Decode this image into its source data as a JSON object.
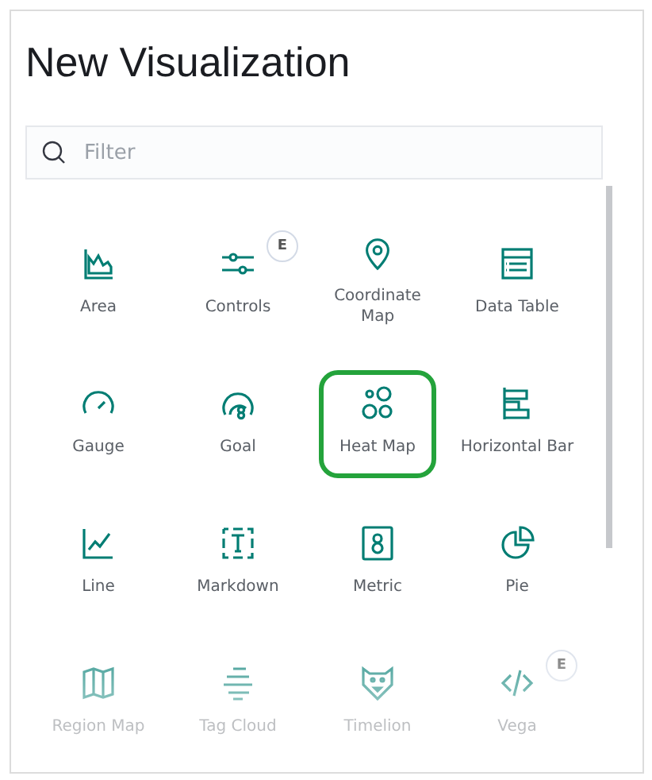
{
  "title": "New Visualization",
  "search": {
    "placeholder": "Filter"
  },
  "items": [
    {
      "label": "Area",
      "highlighted": false
    },
    {
      "label": "Controls",
      "badge": "E",
      "highlighted": false
    },
    {
      "label": "Coordinate Map",
      "highlighted": false
    },
    {
      "label": "Data Table",
      "highlighted": false
    },
    {
      "label": "Gauge",
      "highlighted": false
    },
    {
      "label": "Goal",
      "highlighted": false
    },
    {
      "label": "Heat Map",
      "highlighted": true
    },
    {
      "label": "Horizontal Bar",
      "highlighted": false
    },
    {
      "label": "Line",
      "highlighted": false
    },
    {
      "label": "Markdown",
      "highlighted": false
    },
    {
      "label": "Metric",
      "highlighted": false
    },
    {
      "label": "Pie",
      "highlighted": false
    },
    {
      "label": "Region Map",
      "highlighted": false
    },
    {
      "label": "Tag Cloud",
      "highlighted": false
    },
    {
      "label": "Timelion",
      "highlighted": false
    },
    {
      "label": "Vega",
      "badge": "E",
      "highlighted": false
    }
  ]
}
